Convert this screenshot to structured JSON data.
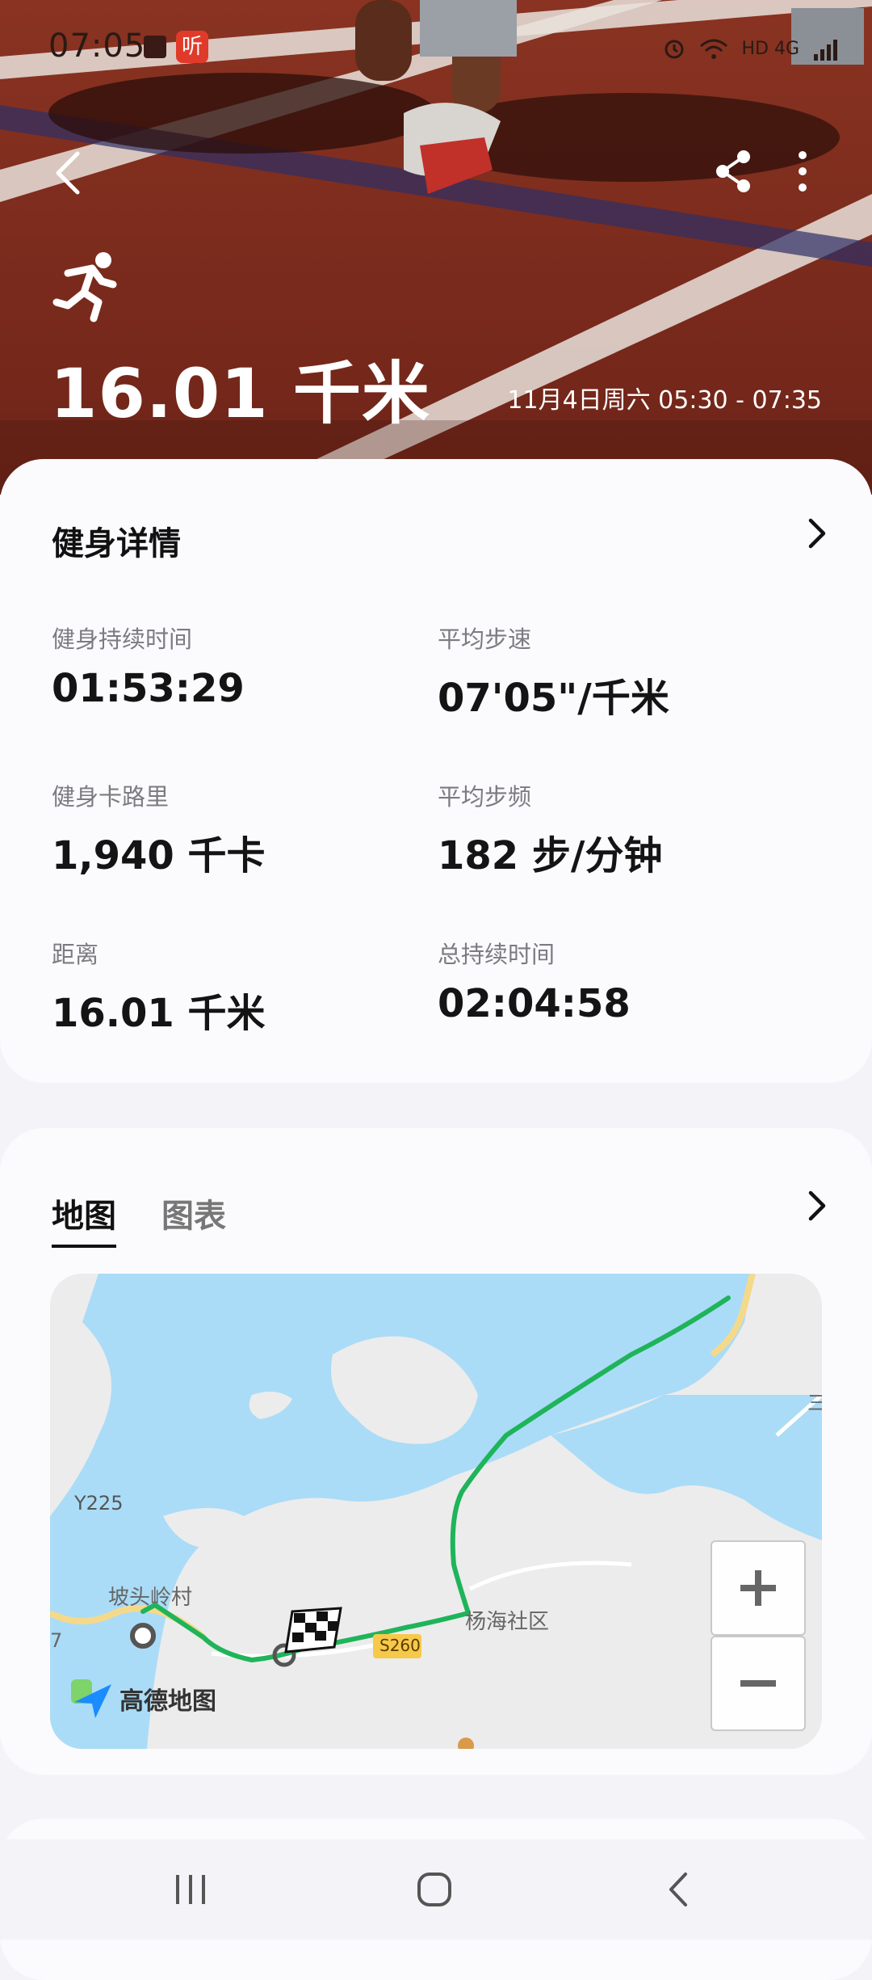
{
  "status_bar": {
    "time": "07:05",
    "app_badge": "听",
    "right_text": "HD 4G"
  },
  "header": {
    "distance": "16.01 千米",
    "date_range": "11月4日周六 05:30 - 07:35",
    "icons": [
      "back-icon",
      "share-icon",
      "more-icon",
      "running-icon"
    ]
  },
  "details": {
    "title": "健身详情",
    "stats": [
      {
        "label": "健身持续时间",
        "value": "01:53:29"
      },
      {
        "label": "平均步速",
        "value": "07'05\"/千米"
      },
      {
        "label": "健身卡路里",
        "value": "1,940 千卡"
      },
      {
        "label": "平均步频",
        "value": "182 步/分钟"
      },
      {
        "label": "距离",
        "value": "16.01 千米"
      },
      {
        "label": "总持续时间",
        "value": "02:04:58"
      }
    ]
  },
  "map_card": {
    "tabs": [
      {
        "label": "地图",
        "active": true
      },
      {
        "label": "图表",
        "active": false
      }
    ],
    "map": {
      "labels": {
        "road_y225": "Y225",
        "village": "坡头岭村",
        "community": "杨海社区",
        "road_s260": "S260",
        "edge_7": "7",
        "edge_right": "三"
      },
      "provider": "高德地图",
      "zoom_in": "+",
      "zoom_out": "−",
      "route_color": "#1fb45a",
      "water_color": "#aadcf7"
    }
  },
  "nav_bar": {
    "icons": [
      "recent-apps-icon",
      "home-icon",
      "back-nav-icon"
    ]
  }
}
